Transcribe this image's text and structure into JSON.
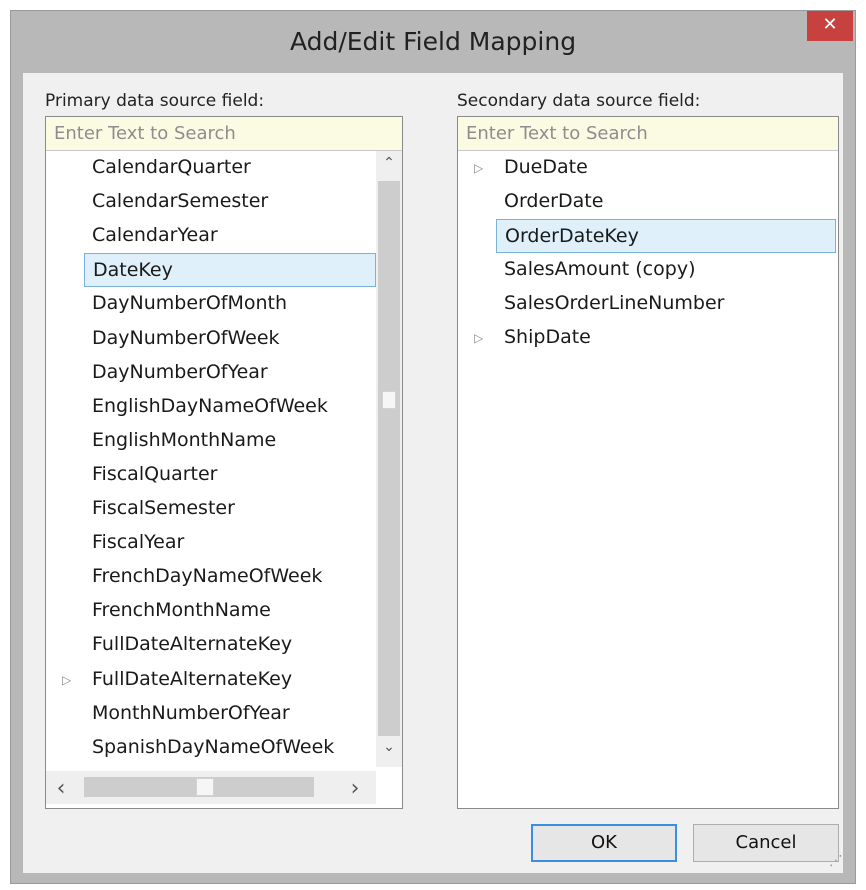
{
  "window": {
    "title": "Add/Edit Field Mapping",
    "close_glyph": "✕"
  },
  "primary": {
    "label": "Primary data source field:",
    "search_placeholder": "Enter Text to Search",
    "items": [
      {
        "label": "CalendarQuarter",
        "expandable": false,
        "selected": false
      },
      {
        "label": "CalendarSemester",
        "expandable": false,
        "selected": false
      },
      {
        "label": "CalendarYear",
        "expandable": false,
        "selected": false
      },
      {
        "label": "DateKey",
        "expandable": false,
        "selected": true
      },
      {
        "label": "DayNumberOfMonth",
        "expandable": false,
        "selected": false
      },
      {
        "label": "DayNumberOfWeek",
        "expandable": false,
        "selected": false
      },
      {
        "label": "DayNumberOfYear",
        "expandable": false,
        "selected": false
      },
      {
        "label": "EnglishDayNameOfWeek",
        "expandable": false,
        "selected": false
      },
      {
        "label": "EnglishMonthName",
        "expandable": false,
        "selected": false
      },
      {
        "label": "FiscalQuarter",
        "expandable": false,
        "selected": false
      },
      {
        "label": "FiscalSemester",
        "expandable": false,
        "selected": false
      },
      {
        "label": "FiscalYear",
        "expandable": false,
        "selected": false
      },
      {
        "label": "FrenchDayNameOfWeek",
        "expandable": false,
        "selected": false
      },
      {
        "label": "FrenchMonthName",
        "expandable": false,
        "selected": false
      },
      {
        "label": "FullDateAlternateKey",
        "expandable": false,
        "selected": false
      },
      {
        "label": "FullDateAlternateKey",
        "expandable": true,
        "selected": false
      },
      {
        "label": "MonthNumberOfYear",
        "expandable": false,
        "selected": false
      },
      {
        "label": "SpanishDayNameOfWeek",
        "expandable": false,
        "selected": false
      }
    ],
    "scroll": {
      "up_arrow": "⌃",
      "down_arrow": "⌄",
      "left_arrow": "‹",
      "right_arrow": "›"
    }
  },
  "secondary": {
    "label": "Secondary data source field:",
    "search_placeholder": "Enter Text to Search",
    "items": [
      {
        "label": "DueDate",
        "expandable": true,
        "selected": false
      },
      {
        "label": "OrderDate",
        "expandable": false,
        "selected": false
      },
      {
        "label": "OrderDateKey",
        "expandable": false,
        "selected": true
      },
      {
        "label": "SalesAmount (copy)",
        "expandable": false,
        "selected": false
      },
      {
        "label": "SalesOrderLineNumber",
        "expandable": false,
        "selected": false
      },
      {
        "label": "ShipDate",
        "expandable": true,
        "selected": false
      }
    ]
  },
  "buttons": {
    "ok_label": "OK",
    "cancel_label": "Cancel"
  },
  "icons": {
    "expander_glyph": "▷",
    "grip_glyph": "⋰"
  }
}
